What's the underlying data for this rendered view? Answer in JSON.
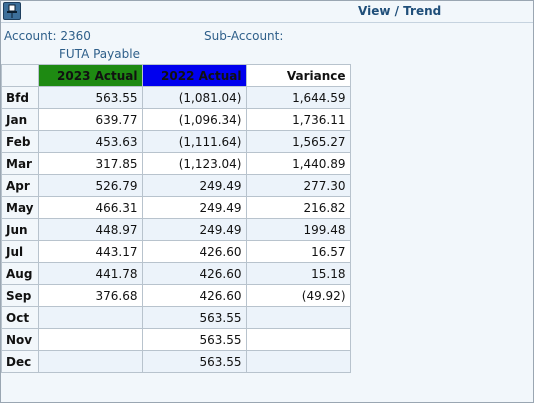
{
  "header": {
    "view_title": "View / Trend",
    "pin_icon": "pin-icon"
  },
  "account": {
    "label": "Account:",
    "number": "2360",
    "name": "FUTA Payable",
    "sub_label": "Sub-Account:",
    "sub_value": ""
  },
  "colors": {
    "col_2023": "#1e8a12",
    "col_2022": "#0000ee",
    "accent": "#1f4e79"
  },
  "table": {
    "columns": [
      "2023 Actual",
      "2022 Actual",
      "Variance"
    ],
    "rows": [
      {
        "period": "Bfd",
        "a2023": "563.55",
        "a2022": "(1,081.04)",
        "variance": "1,644.59"
      },
      {
        "period": "Jan",
        "a2023": "639.77",
        "a2022": "(1,096.34)",
        "variance": "1,736.11"
      },
      {
        "period": "Feb",
        "a2023": "453.63",
        "a2022": "(1,111.64)",
        "variance": "1,565.27"
      },
      {
        "period": "Mar",
        "a2023": "317.85",
        "a2022": "(1,123.04)",
        "variance": "1,440.89"
      },
      {
        "period": "Apr",
        "a2023": "526.79",
        "a2022": "249.49",
        "variance": "277.30"
      },
      {
        "period": "May",
        "a2023": "466.31",
        "a2022": "249.49",
        "variance": "216.82"
      },
      {
        "period": "Jun",
        "a2023": "448.97",
        "a2022": "249.49",
        "variance": "199.48"
      },
      {
        "period": "Jul",
        "a2023": "443.17",
        "a2022": "426.60",
        "variance": "16.57"
      },
      {
        "period": "Aug",
        "a2023": "441.78",
        "a2022": "426.60",
        "variance": "15.18"
      },
      {
        "period": "Sep",
        "a2023": "376.68",
        "a2022": "426.60",
        "variance": "(49.92)"
      },
      {
        "period": "Oct",
        "a2023": "",
        "a2022": "563.55",
        "variance": ""
      },
      {
        "period": "Nov",
        "a2023": "",
        "a2022": "563.55",
        "variance": ""
      },
      {
        "period": "Dec",
        "a2023": "",
        "a2022": "563.55",
        "variance": ""
      }
    ]
  }
}
